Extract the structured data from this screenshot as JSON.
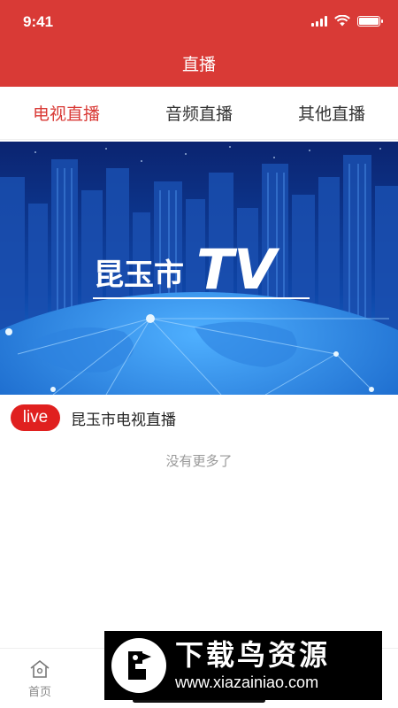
{
  "status_bar": {
    "time": "9:41"
  },
  "header": {
    "title": "直播"
  },
  "tabs": [
    {
      "label": "电视直播",
      "active": true
    },
    {
      "label": "音频直播",
      "active": false
    },
    {
      "label": "其他直播",
      "active": false
    }
  ],
  "banner": {
    "logo_text": "昆玉市",
    "logo_suffix": "TV"
  },
  "live_item": {
    "badge": "live",
    "title": "昆玉市电视直播"
  },
  "list_footer": "没有更多了",
  "bottom_nav": [
    {
      "label": "首页",
      "icon": "home-icon",
      "active": false
    },
    {
      "label": "",
      "icon": "",
      "active": false
    },
    {
      "label": "",
      "icon": "",
      "active": true
    },
    {
      "label": "",
      "icon": "",
      "active": false
    },
    {
      "label": "",
      "icon": "",
      "active": false
    }
  ],
  "watermark": {
    "title": "下载鸟资源",
    "url": "www.xiazainiao.com"
  },
  "colors": {
    "primary": "#d93a36",
    "live_badge": "#e0201f",
    "banner_bg": "#0a2a78"
  }
}
